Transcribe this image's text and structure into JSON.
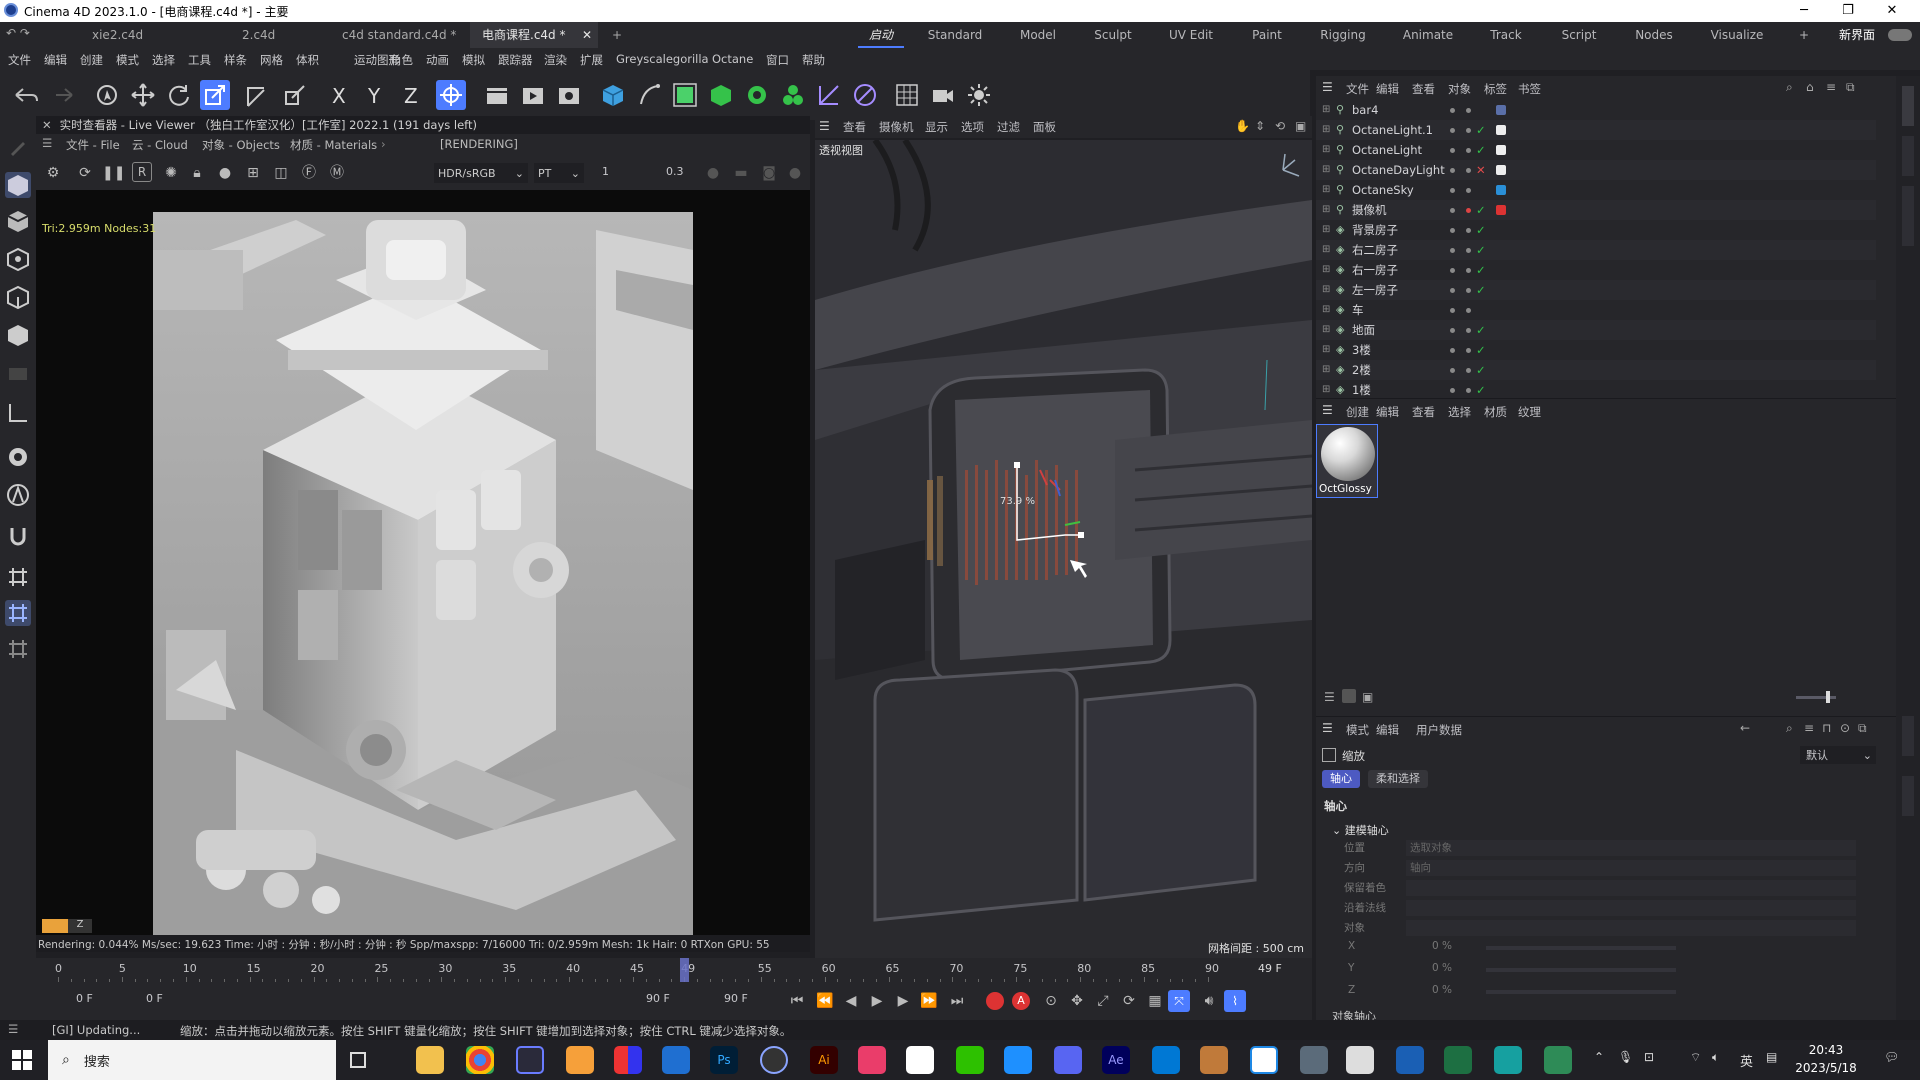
{
  "window": {
    "title": "Cinema 4D 2023.1.0 - [电商课程.c4d *] - 主要",
    "min": "─",
    "max": "❐",
    "close": "✕"
  },
  "tabs": {
    "docs": [
      {
        "label": "xie2.c4d"
      },
      {
        "label": "2.c4d"
      },
      {
        "label": "c4d standard.c4d *"
      },
      {
        "label": "电商课程.c4d *"
      }
    ],
    "close": "✕",
    "add": "+",
    "layouts": [
      {
        "label": "启动"
      },
      {
        "label": "Standard"
      },
      {
        "label": "Model"
      },
      {
        "label": "Sculpt"
      },
      {
        "label": "UV Edit"
      },
      {
        "label": "Paint"
      },
      {
        "label": "Rigging"
      },
      {
        "label": "Animate"
      },
      {
        "label": "Track"
      },
      {
        "label": "Script"
      },
      {
        "label": "Nodes"
      },
      {
        "label": "Visualize"
      }
    ],
    "layout_add": "+",
    "new_interface": "新界面"
  },
  "menubar": [
    "文件",
    "编辑",
    "创建",
    "模式",
    "选择",
    "工具",
    "样条",
    "网格",
    "体积",
    "运动图形",
    "角色",
    "动画",
    "模拟",
    "跟踪器",
    "渲染",
    "扩展",
    "Greyscalegorilla",
    "Octane",
    "窗口",
    "帮助"
  ],
  "liveviewer": {
    "title": "实时查看器 - Live Viewer （独白工作室汉化）[工作室] 2022.1 (191 days left)",
    "menu": [
      "文件 - File",
      "云 - Cloud",
      "对象 - Objects",
      "材质 - Materials"
    ],
    "rendering": "[RENDERING]",
    "colorspace": "HDR/sRGB",
    "kernel": "PT",
    "value1": "1",
    "value2": "0.3",
    "overlay": "Tri:2.959m Nodes:31",
    "status": "Rendering: 0.044% Ms/sec: 19.623   Time: 小时 : 分钟 : 秒/小时 : 分钟 : 秒   Spp/maxspp: 7/16000    Tri: 0/2.959m  Mesh: 1k   Hair: 0  RTXon      GPU:   55",
    "swatch_label": "Z"
  },
  "viewport": {
    "menu": [
      "查看",
      "摄像机",
      "显示",
      "选项",
      "过滤",
      "面板"
    ],
    "label": "透视视图",
    "scale_readout": "73.9 %",
    "grid": "网格间距 : 500 cm"
  },
  "timeline": {
    "ticks": [
      "0",
      "5",
      "10",
      "15",
      "20",
      "25",
      "30",
      "35",
      "40",
      "45",
      "49",
      "55",
      "60",
      "65",
      "70",
      "75",
      "80",
      "85",
      "90"
    ],
    "current": "49 F",
    "current_frame": 49,
    "max_frame": 90,
    "start": "0 F",
    "start2": "0 F",
    "end": "90 F",
    "end2": "90 F"
  },
  "statusbar": {
    "left": "[GI] Updating...",
    "hint": "缩放：点击并拖动以缩放元素。按住 SHIFT 键量化缩放；按住 SHIFT 键增加到选择对象；按住 CTRL 键减少选择对象。"
  },
  "objects": {
    "menu": [
      "文件",
      "编辑",
      "查看",
      "对象",
      "标签",
      "书签"
    ],
    "items": [
      {
        "name": "bar4",
        "check": ""
      },
      {
        "name": "OctaneLight.1",
        "check": "✓"
      },
      {
        "name": "OctaneLight",
        "check": "✓"
      },
      {
        "name": "OctaneDayLight",
        "check": "✕"
      },
      {
        "name": "OctaneSky",
        "check": ""
      },
      {
        "name": "摄像机",
        "check": "✓"
      },
      {
        "name": "背景房子",
        "check": "✓"
      },
      {
        "name": "右二房子",
        "check": "✓"
      },
      {
        "name": "右一房子",
        "check": "✓"
      },
      {
        "name": "左一房子",
        "check": "✓"
      },
      {
        "name": "车",
        "check": ""
      },
      {
        "name": "地面",
        "check": "✓"
      },
      {
        "name": "3楼",
        "check": "✓"
      },
      {
        "name": "2楼",
        "check": "✓"
      },
      {
        "name": "1楼",
        "check": "✓"
      }
    ]
  },
  "materials": {
    "menu": [
      "创建",
      "编辑",
      "查看",
      "选择",
      "材质",
      "纹理"
    ],
    "items": [
      {
        "name": "OctGlossy"
      }
    ]
  },
  "attributes": {
    "menu": [
      "模式",
      "编辑",
      "用户数据"
    ],
    "tool": "缩放",
    "preset": "默认",
    "tabs": [
      "轴心",
      "柔和选择"
    ],
    "section": "轴心",
    "group": "建模轴心",
    "fields": [
      {
        "label": "位置",
        "value": "选取对象"
      },
      {
        "label": "方向",
        "value": "轴向"
      },
      {
        "label": "保留着色",
        "value": ""
      },
      {
        "label": "沿着法线",
        "value": ""
      },
      {
        "label": "对象",
        "value": ""
      }
    ],
    "xyz": [
      {
        "label": "X",
        "value": "0 %"
      },
      {
        "label": "Y",
        "value": "0 %"
      },
      {
        "label": "Z",
        "value": "0 %"
      }
    ],
    "group2": "对象轴心"
  },
  "taskbar": {
    "search": "搜索",
    "ime": "英",
    "time": "20:43",
    "date": "2023/5/18"
  },
  "colors": {
    "accent": "#4d7cff",
    "check": "#31c14a",
    "cross": "#e04b4b"
  }
}
